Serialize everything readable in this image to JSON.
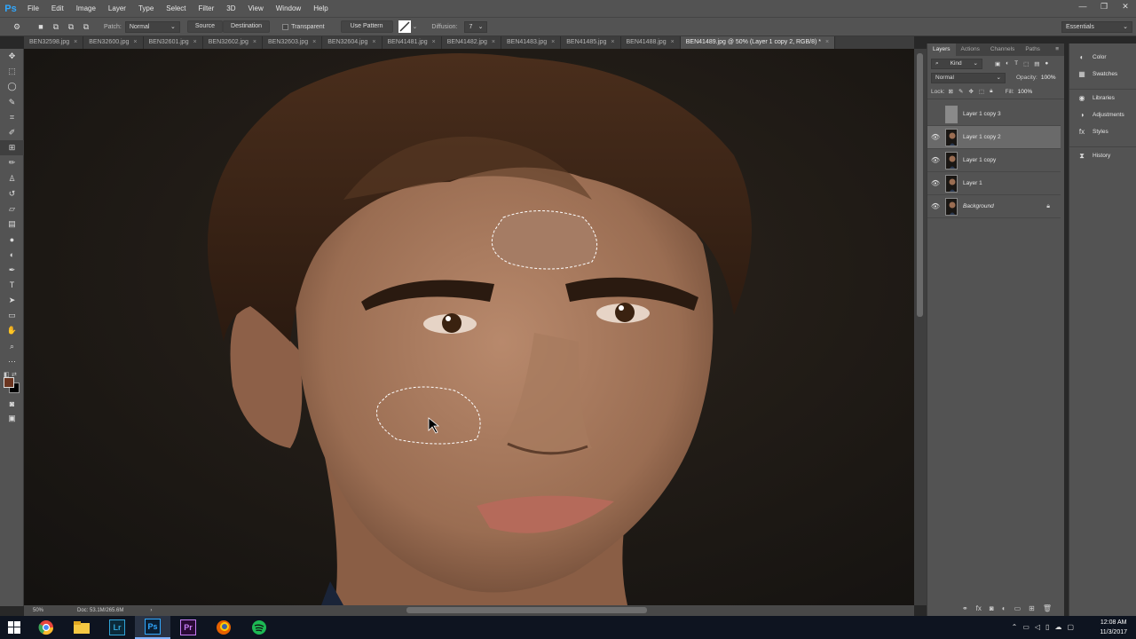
{
  "app": {
    "logo": "Ps"
  },
  "menu": [
    "File",
    "Edit",
    "Image",
    "Layer",
    "Type",
    "Select",
    "Filter",
    "3D",
    "View",
    "Window",
    "Help"
  ],
  "window_controls": [
    "—",
    "❐",
    "✕"
  ],
  "options_bar": {
    "patch_label": "Patch:",
    "patch_mode": "Normal",
    "source_label": "Source",
    "destination_label": "Destination",
    "transparent_label": "Transparent",
    "use_pattern_label": "Use Pattern",
    "diffusion_label": "Diffusion:",
    "diffusion_value": "7",
    "workspace": "Essentials"
  },
  "tabs": [
    {
      "label": "BEN32598.jpg"
    },
    {
      "label": "BEN32600.jpg"
    },
    {
      "label": "BEN32601.jpg"
    },
    {
      "label": "BEN32602.jpg"
    },
    {
      "label": "BEN32603.jpg"
    },
    {
      "label": "BEN32604.jpg"
    },
    {
      "label": "BEN41481.jpg"
    },
    {
      "label": "BEN41482.jpg"
    },
    {
      "label": "BEN41483.jpg"
    },
    {
      "label": "BEN41485.jpg"
    },
    {
      "label": "BEN41488.jpg"
    },
    {
      "label": "BEN41489.jpg @ 50% (Layer 1 copy 2, RGB/8) *"
    }
  ],
  "active_tab_index": 11,
  "status": {
    "zoom": "50%",
    "doc": "Doc: 53.1M/265.6M"
  },
  "layers_panel": {
    "tabs": [
      "Layers",
      "Actions",
      "Channels",
      "Paths"
    ],
    "kind_label": "Kind",
    "blend_mode": "Normal",
    "opacity_label": "Opacity:",
    "opacity_value": "100%",
    "lock_label": "Lock:",
    "fill_label": "Fill:",
    "fill_value": "100%",
    "layers": [
      {
        "name": "Layer 1 copy 3",
        "visible": false,
        "selected": false,
        "italic": false
      },
      {
        "name": "Layer 1 copy 2",
        "visible": true,
        "selected": true,
        "italic": false
      },
      {
        "name": "Layer 1 copy",
        "visible": true,
        "selected": false,
        "italic": false
      },
      {
        "name": "Layer 1",
        "visible": true,
        "selected": false,
        "italic": false
      },
      {
        "name": "Background",
        "visible": true,
        "selected": false,
        "italic": true
      }
    ]
  },
  "right_panels": [
    {
      "label": "Color",
      "icon": "color-icon"
    },
    {
      "label": "Swatches",
      "icon": "swatches-icon"
    },
    {
      "label": "Libraries",
      "icon": "libraries-icon"
    },
    {
      "label": "Adjustments",
      "icon": "adjustments-icon"
    },
    {
      "label": "Styles",
      "icon": "styles-icon"
    },
    {
      "label": "History",
      "icon": "history-icon"
    }
  ],
  "taskbar": {
    "apps": [
      {
        "name": "windows-start-icon",
        "label": ""
      },
      {
        "name": "chrome-icon",
        "label": ""
      },
      {
        "name": "file-explorer-icon",
        "label": ""
      },
      {
        "name": "lightroom-icon",
        "label": "Lr"
      },
      {
        "name": "photoshop-icon",
        "label": "Ps"
      },
      {
        "name": "premiere-icon",
        "label": "Pr"
      },
      {
        "name": "firefox-icon",
        "label": ""
      },
      {
        "name": "spotify-icon",
        "label": ""
      }
    ],
    "time": "12:08 AM",
    "date": "11/3/2017"
  }
}
